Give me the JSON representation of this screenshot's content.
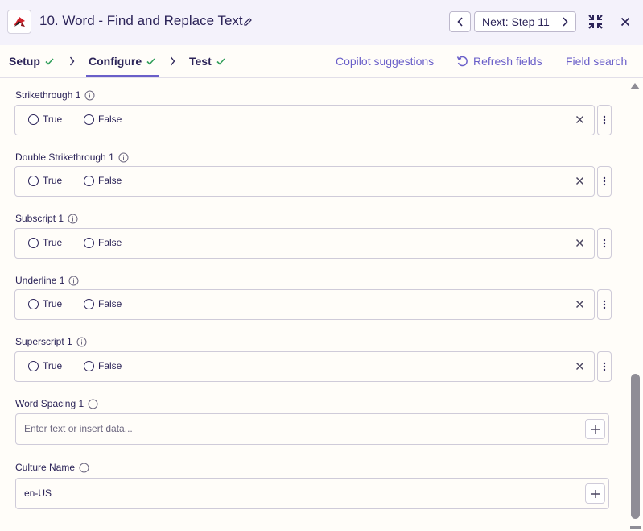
{
  "header": {
    "step_title": "10. Word - Find and Replace Text",
    "next_label": "Next: Step 11"
  },
  "tabs": [
    {
      "label": "Setup",
      "status": "complete"
    },
    {
      "label": "Configure",
      "status": "complete",
      "active": true
    },
    {
      "label": "Test",
      "status": "complete"
    }
  ],
  "actions": {
    "copilot": "Copilot suggestions",
    "refresh": "Refresh fields",
    "field_search": "Field search"
  },
  "radio_fields": [
    {
      "label": "Strikethrough 1",
      "options": [
        "True",
        "False"
      ]
    },
    {
      "label": "Double Strikethrough 1",
      "options": [
        "True",
        "False"
      ]
    },
    {
      "label": "Subscript 1",
      "options": [
        "True",
        "False"
      ]
    },
    {
      "label": "Underline 1",
      "options": [
        "True",
        "False"
      ]
    },
    {
      "label": "Superscript 1",
      "options": [
        "True",
        "False"
      ]
    }
  ],
  "text_fields": [
    {
      "label": "Word Spacing 1",
      "value": "",
      "placeholder": "Enter text or insert data..."
    },
    {
      "label": "Culture Name",
      "value": "en-US",
      "placeholder": ""
    }
  ],
  "colors": {
    "accent": "#6a5fc9",
    "check": "#2f9e5a",
    "text": "#2b2358",
    "header_bg": "#f4f2fb"
  },
  "icons": [
    "app-logo-icon",
    "pencil-icon",
    "chevron-left-icon",
    "chevron-right-icon",
    "collapse-icon",
    "close-icon",
    "checkmark-icon",
    "refresh-icon",
    "info-icon",
    "clear-x-icon",
    "kebab-icon",
    "plus-icon"
  ]
}
